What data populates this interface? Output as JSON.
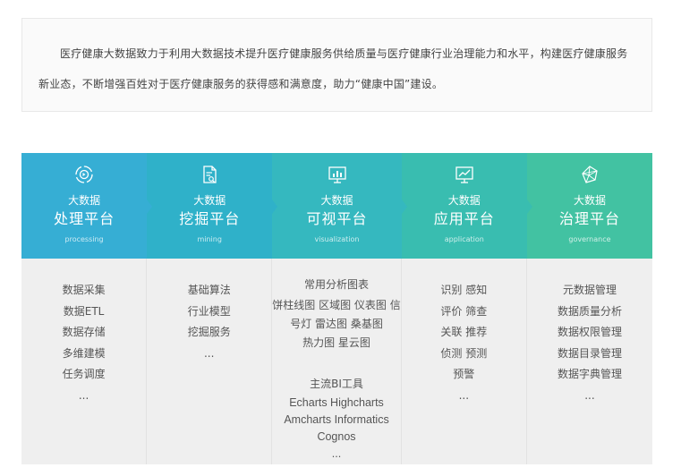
{
  "intro": {
    "text": "医疗健康大数据致力于利用大数据技术提升医疗健康服务供给质量与医疗健康行业治理能力和水平，构建医疗健康服务新业态，不断增强百姓对于医疗健康服务的获得感和满意度，助力“健康中国”建设。"
  },
  "cards": [
    {
      "icon": "processing-cycle-icon",
      "label_small": "大数据",
      "label_big": "处理平台",
      "label_en": "processing",
      "items": [
        "数据采集",
        "数据ETL",
        "数据存储",
        "多维建模",
        "任务调度",
        "..."
      ]
    },
    {
      "icon": "document-mining-icon",
      "label_small": "大数据",
      "label_big": "挖掘平台",
      "label_en": "mining",
      "items": [
        "基础算法",
        "行业模型",
        "挖掘服务",
        "..."
      ]
    },
    {
      "icon": "bar-chart-screen-icon",
      "label_small": "大数据",
      "label_big": "可视平台",
      "label_en": "visualization",
      "section1_title": "常用分析图表",
      "section1_lines": [
        "饼柱线图 区域图 仪表图 信",
        "号灯 雷达图 桑基图",
        "热力图 星云图"
      ],
      "section2_title": "主流BI工具",
      "section2_lines": [
        "Echarts Highcharts",
        "Amcharts Informatics",
        "Cognos",
        "..."
      ]
    },
    {
      "icon": "line-chart-screen-icon",
      "label_small": "大数据",
      "label_big": "应用平台",
      "label_en": "application",
      "items": [
        "识别 感知",
        "评价 筛查",
        "关联 推荐",
        "侦测 预测",
        "预警",
        "..."
      ]
    },
    {
      "icon": "network-polyhedron-icon",
      "label_small": "大数据",
      "label_big": "治理平台",
      "label_en": "governance",
      "items": [
        "元数据管理",
        "数据质量分析",
        "数据权限管理",
        "数据目录管理",
        "数据字典管理",
        "..."
      ]
    }
  ]
}
